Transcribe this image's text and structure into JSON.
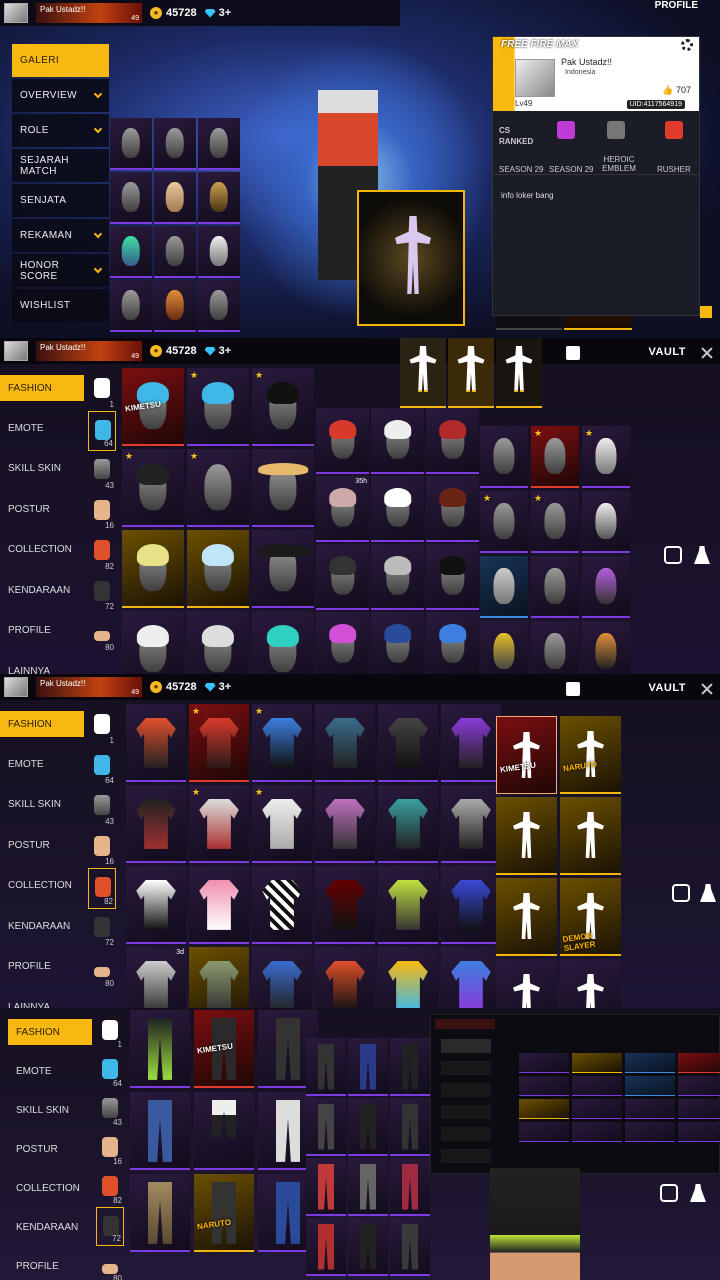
{
  "player": {
    "name": "Pak  Ustadz!!",
    "level": "49",
    "country": "Indonesia",
    "uid": "UID:4117564919",
    "likes": "707",
    "level_label": "Lv49"
  },
  "currency": {
    "gold": "45728",
    "diamonds": "3+"
  },
  "profile_panel": {
    "title": "PROFILE",
    "logo": "FREE FIRE MAX",
    "ranked_label": "CS RANKED",
    "season1": "SEASON 29",
    "season2": "SEASON 29",
    "emblem_label": "HEROIC EMBLEM",
    "rusher_label": "RUSHER",
    "signature": "info loker bang"
  },
  "left_menu": [
    {
      "label": "GALERI",
      "active": true,
      "chevron": false
    },
    {
      "label": "OVERVIEW",
      "active": false,
      "chevron": true
    },
    {
      "label": "ROLE",
      "active": false,
      "chevron": true
    },
    {
      "label": "SEJARAH MATCH",
      "active": false,
      "chevron": false
    },
    {
      "label": "SENJATA",
      "active": false,
      "chevron": false
    },
    {
      "label": "REKAMAN",
      "active": false,
      "chevron": true
    },
    {
      "label": "HONOR SCORE",
      "active": false,
      "chevron": true
    },
    {
      "label": "WISHLIST",
      "active": false,
      "chevron": false
    }
  ],
  "vault": {
    "title": "VAULT"
  },
  "vault_tabs": [
    {
      "label": "FASHION"
    },
    {
      "label": "EMOTE"
    },
    {
      "label": "SKILL SKIN"
    },
    {
      "label": "POSTUR"
    },
    {
      "label": "COLLECTION"
    },
    {
      "label": "KENDARAAN"
    },
    {
      "label": "PROFILE"
    },
    {
      "label": "LAINNYA"
    }
  ],
  "tab_counts": [
    "1",
    "64",
    "43",
    "16",
    "82",
    "72",
    "80"
  ],
  "badges": {
    "timer_35h": "35h",
    "timer_3d": "3d",
    "naruto": "NARUTO",
    "kimetsu": "KIMETSU",
    "demonslayer": "DEMON SLAYER"
  },
  "icons": [
    "coin-icon",
    "diamond-icon",
    "gear-icon",
    "close-icon",
    "chevron-down-icon",
    "like-icon",
    "vault-icon"
  ]
}
